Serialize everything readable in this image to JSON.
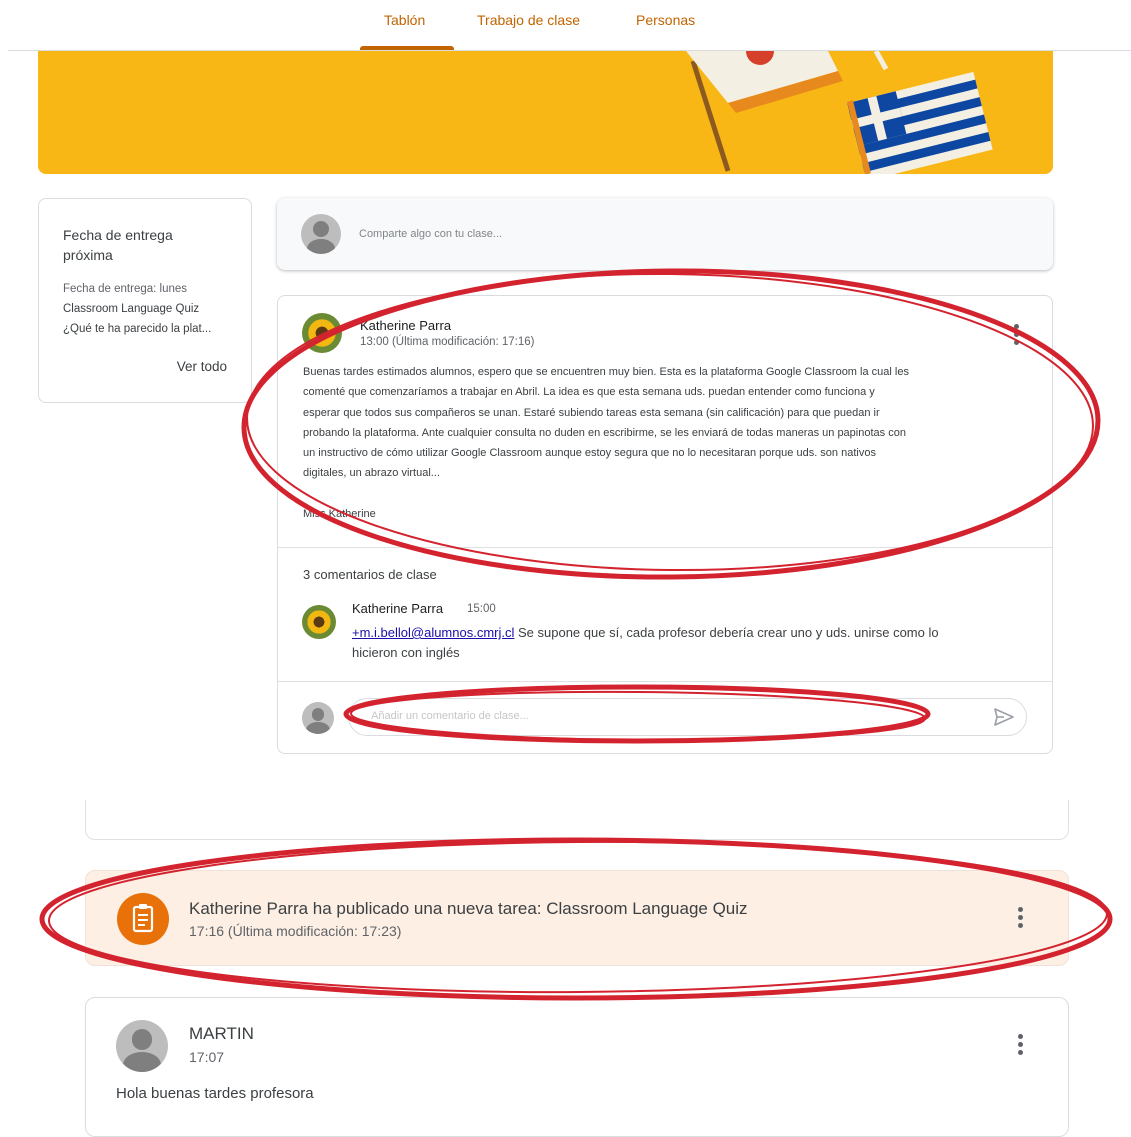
{
  "nav": {
    "tabs": [
      {
        "label": "Tablón",
        "active": true
      },
      {
        "label": "Trabajo de clase",
        "active": false
      },
      {
        "label": "Personas",
        "active": false
      }
    ],
    "accent_color": "#c26401"
  },
  "banner": {
    "color": "#f9b716"
  },
  "sidebar": {
    "title": "Fecha de entrega próxima",
    "due_label": "Fecha de entrega: lunes",
    "item_1": "Classroom Language Quiz",
    "item_2": "¿Qué te ha parecido la plat...",
    "view_all": "Ver todo"
  },
  "share": {
    "placeholder": "Comparte algo con tu clase..."
  },
  "post": {
    "author": "Katherine Parra",
    "time": "13:00 (Última modificación: 17:16)",
    "lines": [
      "Buenas tardes estimados alumnos, espero que se encuentren muy bien. Esta es la plataforma Google Classroom la cual les",
      "comenté que comenzaríamos a trabajar en Abril. La idea es que esta semana uds. puedan entender como funciona y",
      "esperar que todos sus compañeros se unan. Estaré subiendo tareas esta semana (sin calificación) para que puedan ir",
      "probando la plataforma. Ante cualquier consulta no duden en escribirme, se les enviará de todas maneras un papinotas con",
      "un instructivo de cómo utilizar Google Classroom aunque estoy segura que no lo necesitaran porque uds. son nativos",
      "digitales, un abrazo virtual..."
    ],
    "signature": "Miss Katherine",
    "comments_count": "3 comentarios de clase",
    "comment": {
      "author": "Katherine Parra",
      "time": "15:00",
      "mention": "+m.i.bellol@alumnos.cmrj.cl",
      "text_1": " Se supone que sí, cada profesor debería crear uno y uds. unirse como lo",
      "text_2": "hicieron con inglés"
    },
    "comment_placeholder": "Añadir un comentario de clase..."
  },
  "assignment": {
    "title": "Katherine Parra ha publicado una nueva tarea: Classroom Language Quiz",
    "time": "17:16 (Última modificación: 17:23)",
    "color": "#e8710a"
  },
  "martin_post": {
    "author": "MARTIN",
    "time": "17:07",
    "text": "Hola buenas tardes profesora"
  },
  "annotation_color": "#d3232e"
}
